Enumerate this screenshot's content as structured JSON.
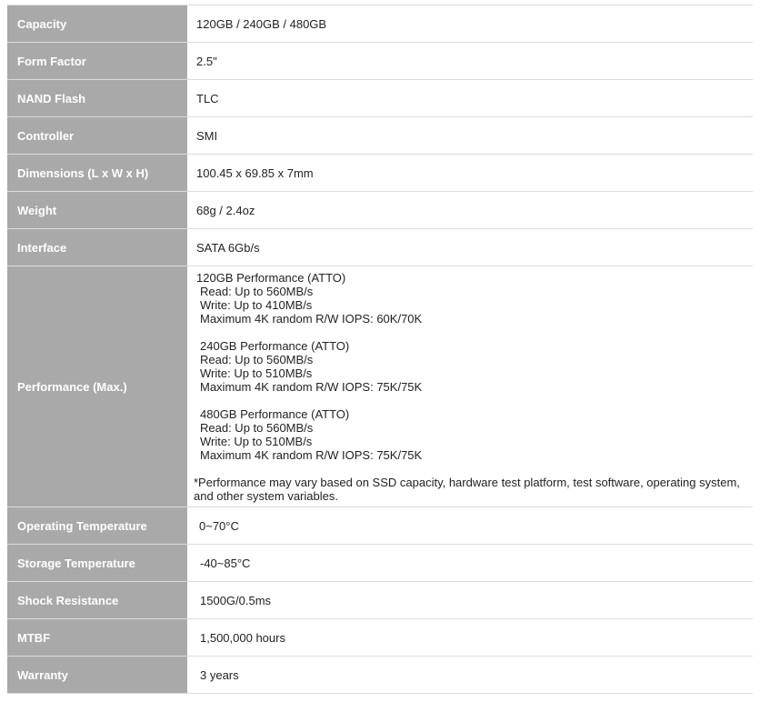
{
  "specs": [
    {
      "label": "Capacity",
      "value": "120GB / 240GB / 480GB"
    },
    {
      "label": "Form Factor",
      "value": "2.5\""
    },
    {
      "label": "NAND Flash",
      "value": "TLC"
    },
    {
      "label": "Controller",
      "value": "SMI"
    },
    {
      "label": "Dimensions (L x W x H)",
      "value": "100.45 x 69.85 x 7mm"
    },
    {
      "label": "Weight",
      "value": "68g / 2.4oz"
    },
    {
      "label": "Interface",
      "value": "SATA 6Gb/s"
    },
    {
      "label": "Performance (Max.)",
      "blocks": [
        {
          "title": "120GB Performance (ATTO)",
          "read": "Read: Up to 560MB/s",
          "write": "Write: Up to 410MB/s",
          "iops": "Maximum 4K random R/W IOPS: 60K/70K"
        },
        {
          "title": "240GB Performance (ATTO)",
          "read": "Read: Up to 560MB/s",
          "write": "Write: Up to 510MB/s",
          "iops": "Maximum 4K random R/W IOPS: 75K/75K"
        },
        {
          "title": "480GB Performance (ATTO)",
          "read": "Read: Up to 560MB/s",
          "write": "Write: Up to 510MB/s",
          "iops": "Maximum 4K random R/W IOPS: 75K/75K"
        }
      ],
      "note_line1": "*Performance may vary based on SSD capacity, hardware test platform, test software, operating system,",
      "note_line2": "and other system variables."
    },
    {
      "label": "Operating Temperature",
      "value": "0~70°C"
    },
    {
      "label": "Storage Temperature",
      "value": "-40~85°C"
    },
    {
      "label": "Shock Resistance",
      "value": "1500G/0.5ms"
    },
    {
      "label": "MTBF",
      "value": "1,500,000 hours"
    },
    {
      "label": "Warranty",
      "value": "3 years"
    }
  ]
}
